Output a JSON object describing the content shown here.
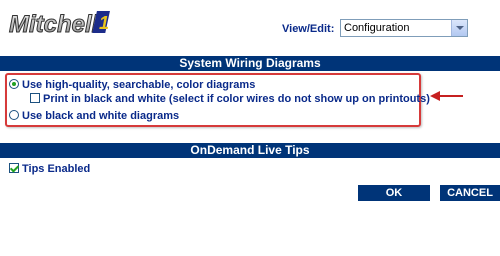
{
  "brand": {
    "logo_text": "Mitchell1"
  },
  "view_edit": {
    "label": "View/Edit:",
    "selected": "Configuration"
  },
  "wiring_section": {
    "title": "System Wiring Diagrams",
    "option_color": "Use high-quality, searchable, color diagrams",
    "option_print_bw": "Print in black and white (select if color wires do not show up on printouts)",
    "option_bw": "Use black and white diagrams"
  },
  "tips_section": {
    "title": "OnDemand Live Tips",
    "tips_enabled": "Tips Enabled"
  },
  "buttons": {
    "ok": "OK",
    "cancel": "CANCEL"
  },
  "colors": {
    "header_bg": "#003478",
    "label_text": "#0a2a8a",
    "highlight_border": "#d63a3a",
    "arrow": "#c62020"
  },
  "icons": {
    "annotation": "red-arrow-icon",
    "dropdown": "chevron-down-icon"
  }
}
